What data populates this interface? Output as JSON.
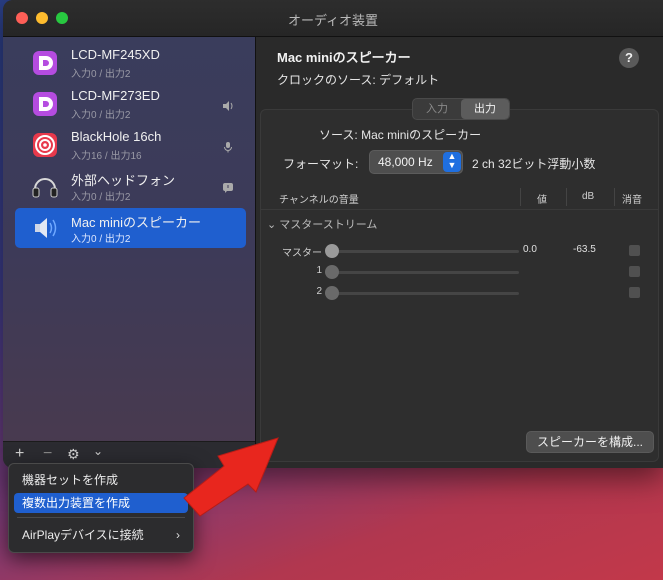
{
  "window_title": "オーディオ装置",
  "devices": [
    {
      "name": "LCD-MF245XD",
      "sub": "入力0 / 出力2",
      "badge": ""
    },
    {
      "name": "LCD-MF273ED",
      "sub": "入力0 / 出力2",
      "badge": "speaker"
    },
    {
      "name": "BlackHole 16ch",
      "sub": "入力16 / 出力16",
      "badge": "mic"
    },
    {
      "name": "外部ヘッドフォン",
      "sub": "入力0 / 出力2",
      "badge": "alert"
    },
    {
      "name": "Mac miniのスピーカー",
      "sub": "入力0 / 出力2",
      "badge": ""
    }
  ],
  "main": {
    "title": "Mac miniのスピーカー",
    "clock": "クロックのソース:  デフォルト",
    "help": "?",
    "tabs": [
      "入力",
      "出力"
    ],
    "source": "ソース:  Mac miniのスピーカー",
    "format_label": "フォーマット:",
    "format_value": "48,000 Hz",
    "format_desc": "2 ch 32ビット浮動小数",
    "table_headers": {
      "channel": "チャンネルの音量",
      "value": "値",
      "db": "dB",
      "mute": "消音"
    },
    "stream_label": "マスターストリーム",
    "rows": [
      {
        "label": "マスター",
        "value": "0.0",
        "db": "-63.5"
      },
      {
        "label": "1",
        "value": "",
        "db": ""
      },
      {
        "label": "2",
        "value": "",
        "db": ""
      }
    ],
    "config_button": "スピーカーを構成..."
  },
  "footer": {
    "add": "+",
    "remove": "−",
    "gear": "⚙",
    "chevron": "⌄"
  },
  "menu": {
    "items": [
      "機器セットを作成",
      "複数出力装置を作成",
      "AirPlayデバイスに接続"
    ],
    "chevron": "›"
  },
  "colors": {
    "accent": "#1f5fcf",
    "arrow": "#e8261e"
  }
}
